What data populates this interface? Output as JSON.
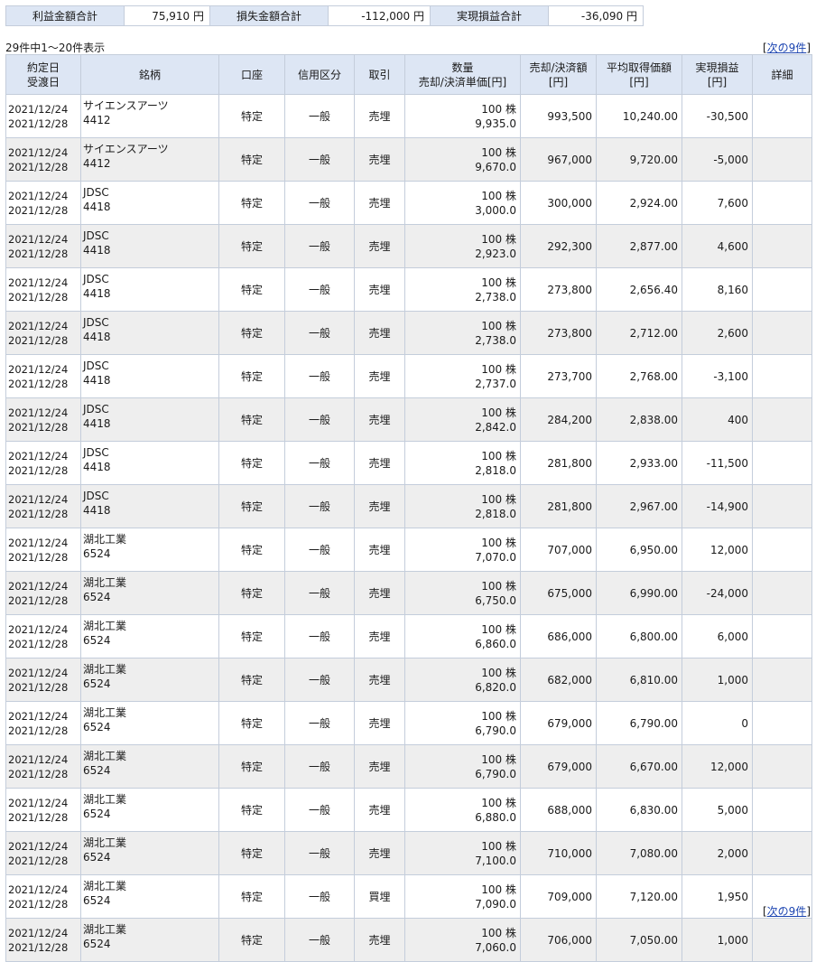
{
  "summary": {
    "profit_label": "利益金額合計",
    "profit_value": "75,910 円",
    "loss_label": "損失金額合計",
    "loss_value": "-112,000 円",
    "realized_label": "実現損益合計",
    "realized_value": "-36,090 円"
  },
  "paging": {
    "count_text": "29件中1〜20件表示",
    "bracket_open": "[",
    "next_label": "次の9件",
    "bracket_close": "]"
  },
  "headers": {
    "date_l1": "約定日",
    "date_l2": "受渡日",
    "name": "銘柄",
    "account": "口座",
    "credit": "信用区分",
    "trade": "取引",
    "qty_l1": "数量",
    "qty_l2": "売却/決済単価[円]",
    "amount_l1": "売却/決済額",
    "amount_l2": "[円]",
    "avg_l1": "平均取得価額",
    "avg_l2": "[円]",
    "pl_l1": "実現損益",
    "pl_l2": "[円]",
    "detail": "詳細"
  },
  "rows": [
    {
      "trade_date": "2021/12/24",
      "settle_date": "2021/12/28",
      "name": "サイエンスアーツ",
      "code": "4412",
      "account": "特定",
      "credit": "一般",
      "trade": "売埋",
      "qty": "100 株",
      "price": "9,935.0",
      "amount": "993,500",
      "avg_cost": "10,240.00",
      "pl": "-30,500"
    },
    {
      "trade_date": "2021/12/24",
      "settle_date": "2021/12/28",
      "name": "サイエンスアーツ",
      "code": "4412",
      "account": "特定",
      "credit": "一般",
      "trade": "売埋",
      "qty": "100 株",
      "price": "9,670.0",
      "amount": "967,000",
      "avg_cost": "9,720.00",
      "pl": "-5,000"
    },
    {
      "trade_date": "2021/12/24",
      "settle_date": "2021/12/28",
      "name": "JDSC",
      "code": "4418",
      "account": "特定",
      "credit": "一般",
      "trade": "売埋",
      "qty": "100 株",
      "price": "3,000.0",
      "amount": "300,000",
      "avg_cost": "2,924.00",
      "pl": "7,600"
    },
    {
      "trade_date": "2021/12/24",
      "settle_date": "2021/12/28",
      "name": "JDSC",
      "code": "4418",
      "account": "特定",
      "credit": "一般",
      "trade": "売埋",
      "qty": "100 株",
      "price": "2,923.0",
      "amount": "292,300",
      "avg_cost": "2,877.00",
      "pl": "4,600"
    },
    {
      "trade_date": "2021/12/24",
      "settle_date": "2021/12/28",
      "name": "JDSC",
      "code": "4418",
      "account": "特定",
      "credit": "一般",
      "trade": "売埋",
      "qty": "100 株",
      "price": "2,738.0",
      "amount": "273,800",
      "avg_cost": "2,656.40",
      "pl": "8,160"
    },
    {
      "trade_date": "2021/12/24",
      "settle_date": "2021/12/28",
      "name": "JDSC",
      "code": "4418",
      "account": "特定",
      "credit": "一般",
      "trade": "売埋",
      "qty": "100 株",
      "price": "2,738.0",
      "amount": "273,800",
      "avg_cost": "2,712.00",
      "pl": "2,600"
    },
    {
      "trade_date": "2021/12/24",
      "settle_date": "2021/12/28",
      "name": "JDSC",
      "code": "4418",
      "account": "特定",
      "credit": "一般",
      "trade": "売埋",
      "qty": "100 株",
      "price": "2,737.0",
      "amount": "273,700",
      "avg_cost": "2,768.00",
      "pl": "-3,100"
    },
    {
      "trade_date": "2021/12/24",
      "settle_date": "2021/12/28",
      "name": "JDSC",
      "code": "4418",
      "account": "特定",
      "credit": "一般",
      "trade": "売埋",
      "qty": "100 株",
      "price": "2,842.0",
      "amount": "284,200",
      "avg_cost": "2,838.00",
      "pl": "400"
    },
    {
      "trade_date": "2021/12/24",
      "settle_date": "2021/12/28",
      "name": "JDSC",
      "code": "4418",
      "account": "特定",
      "credit": "一般",
      "trade": "売埋",
      "qty": "100 株",
      "price": "2,818.0",
      "amount": "281,800",
      "avg_cost": "2,933.00",
      "pl": "-11,500"
    },
    {
      "trade_date": "2021/12/24",
      "settle_date": "2021/12/28",
      "name": "JDSC",
      "code": "4418",
      "account": "特定",
      "credit": "一般",
      "trade": "売埋",
      "qty": "100 株",
      "price": "2,818.0",
      "amount": "281,800",
      "avg_cost": "2,967.00",
      "pl": "-14,900"
    },
    {
      "trade_date": "2021/12/24",
      "settle_date": "2021/12/28",
      "name": "湖北工業",
      "code": "6524",
      "account": "特定",
      "credit": "一般",
      "trade": "売埋",
      "qty": "100 株",
      "price": "7,070.0",
      "amount": "707,000",
      "avg_cost": "6,950.00",
      "pl": "12,000"
    },
    {
      "trade_date": "2021/12/24",
      "settle_date": "2021/12/28",
      "name": "湖北工業",
      "code": "6524",
      "account": "特定",
      "credit": "一般",
      "trade": "売埋",
      "qty": "100 株",
      "price": "6,750.0",
      "amount": "675,000",
      "avg_cost": "6,990.00",
      "pl": "-24,000"
    },
    {
      "trade_date": "2021/12/24",
      "settle_date": "2021/12/28",
      "name": "湖北工業",
      "code": "6524",
      "account": "特定",
      "credit": "一般",
      "trade": "売埋",
      "qty": "100 株",
      "price": "6,860.0",
      "amount": "686,000",
      "avg_cost": "6,800.00",
      "pl": "6,000"
    },
    {
      "trade_date": "2021/12/24",
      "settle_date": "2021/12/28",
      "name": "湖北工業",
      "code": "6524",
      "account": "特定",
      "credit": "一般",
      "trade": "売埋",
      "qty": "100 株",
      "price": "6,820.0",
      "amount": "682,000",
      "avg_cost": "6,810.00",
      "pl": "1,000"
    },
    {
      "trade_date": "2021/12/24",
      "settle_date": "2021/12/28",
      "name": "湖北工業",
      "code": "6524",
      "account": "特定",
      "credit": "一般",
      "trade": "売埋",
      "qty": "100 株",
      "price": "6,790.0",
      "amount": "679,000",
      "avg_cost": "6,790.00",
      "pl": "0"
    },
    {
      "trade_date": "2021/12/24",
      "settle_date": "2021/12/28",
      "name": "湖北工業",
      "code": "6524",
      "account": "特定",
      "credit": "一般",
      "trade": "売埋",
      "qty": "100 株",
      "price": "6,790.0",
      "amount": "679,000",
      "avg_cost": "6,670.00",
      "pl": "12,000"
    },
    {
      "trade_date": "2021/12/24",
      "settle_date": "2021/12/28",
      "name": "湖北工業",
      "code": "6524",
      "account": "特定",
      "credit": "一般",
      "trade": "売埋",
      "qty": "100 株",
      "price": "6,880.0",
      "amount": "688,000",
      "avg_cost": "6,830.00",
      "pl": "5,000"
    },
    {
      "trade_date": "2021/12/24",
      "settle_date": "2021/12/28",
      "name": "湖北工業",
      "code": "6524",
      "account": "特定",
      "credit": "一般",
      "trade": "売埋",
      "qty": "100 株",
      "price": "7,100.0",
      "amount": "710,000",
      "avg_cost": "7,080.00",
      "pl": "2,000"
    },
    {
      "trade_date": "2021/12/24",
      "settle_date": "2021/12/28",
      "name": "湖北工業",
      "code": "6524",
      "account": "特定",
      "credit": "一般",
      "trade": "買埋",
      "qty": "100 株",
      "price": "7,090.0",
      "amount": "709,000",
      "avg_cost": "7,120.00",
      "pl": "1,950"
    },
    {
      "trade_date": "2021/12/24",
      "settle_date": "2021/12/28",
      "name": "湖北工業",
      "code": "6524",
      "account": "特定",
      "credit": "一般",
      "trade": "売埋",
      "qty": "100 株",
      "price": "7,060.0",
      "amount": "706,000",
      "avg_cost": "7,050.00",
      "pl": "1,000"
    }
  ]
}
